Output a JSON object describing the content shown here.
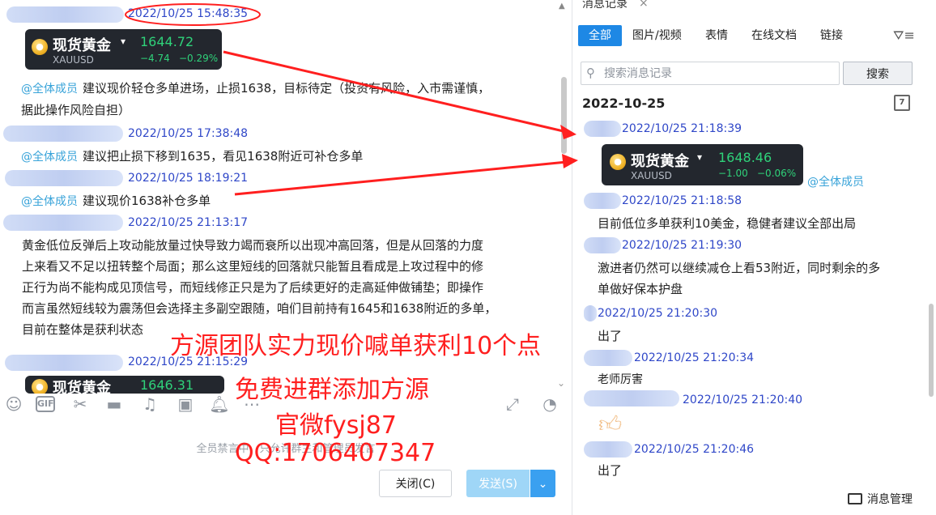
{
  "chat": {
    "messages": [
      {
        "time": "2022/10/25 15:48:35"
      },
      {
        "mention": "@全体成员",
        "text": "建议现价轻仓多单进场，止损1638，目标待定（投资有风险，入市需谨慎，",
        "text2": "据此操作风险自担）"
      },
      {
        "time": "2022/10/25 17:38:48"
      },
      {
        "mention": "@全体成员",
        "text": "建议把止损下移到1635，看见1638附近可补仓多单"
      },
      {
        "time": "2022/10/25 18:19:21"
      },
      {
        "mention": "@全体成员",
        "text": "建议现价1638补仓多单"
      },
      {
        "time": "2022/10/25 21:13:17"
      },
      {
        "lines": [
          "黄金低位反弹后上攻动能放量过快导致力竭而衰所以出现冲高回落，但是从回落的力度",
          "上来看又不足以扭转整个局面；那么这里短线的回落就只能暂且看成是上攻过程中的修",
          "正行为尚不能构成见顶信号，而短线修正只是为了后续更好的走高延伸做铺垫；即操作",
          "而言虽然短线较为震荡但会选择主多副空跟随，咱们目前持有1645和1638附近的多单，",
          "目前在整体是获利状态"
        ]
      },
      {
        "time": "2022/10/25 21:15:29"
      }
    ],
    "cards": [
      {
        "name": "现货黄金",
        "symbol": "XAUUSD",
        "price": "1644.72",
        "change": "−4.74",
        "pct": "−0.29%"
      },
      {
        "name": "现货黄金",
        "price": "1646.31"
      }
    ],
    "muted_notice": "全员禁言中，只允许群主和管理员发言",
    "close_label": "关闭(C)",
    "send_label": "发送(S)",
    "send_drop": "⌄"
  },
  "panel": {
    "tab_title": "消息记录",
    "tab_close": "×",
    "filter_tabs": [
      "全部",
      "图片/视频",
      "表情",
      "在线文档",
      "链接"
    ],
    "search_placeholder": "搜索消息记录",
    "search_button": "搜索",
    "date_header": "2022-10-25",
    "calendar_day": "7",
    "records": [
      {
        "time": "2022/10/25 21:18:39"
      },
      {
        "time": "2022/10/25 21:18:58",
        "text": "目前低位多单获利10美金，稳健者建议全部出局"
      },
      {
        "time": "2022/10/25 21:19:30",
        "text": "激进者仍然可以继续减仓上看53附近，同时剩余的多",
        "text2": "单做好保本护盘"
      },
      {
        "time": "2022/10/25 21:20:30",
        "text": "出了"
      },
      {
        "time": "2022/10/25 21:20:34",
        "text": "老师厉害"
      },
      {
        "time": "2022/10/25 21:20:40"
      },
      {
        "time": "2022/10/25 21:20:46",
        "text": "出了"
      }
    ],
    "card": {
      "name": "现货黄金",
      "symbol": "XAUUSD",
      "price": "1648.46",
      "change": "−1.00",
      "pct": "−0.06%"
    },
    "card_mention": "@全体成员",
    "message_manage": "消息管理"
  },
  "promo": {
    "line1": "方源团队实力现价喊单获利10个点",
    "line2": "免费进群添加方源",
    "line3": "官微fysj87",
    "line4": "QQ:1706407347"
  },
  "colors": {
    "accent": "#1e88e5",
    "timestamp": "#2f47c8",
    "mention": "#38a3d9",
    "promo": "#ff1f1f",
    "price_up": "#2fd27a"
  }
}
